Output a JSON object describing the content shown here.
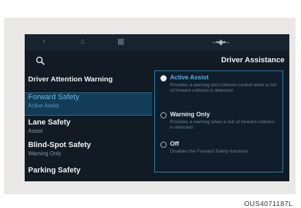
{
  "status_icons": {
    "back": "back-arrow-icon",
    "home": "home-icon",
    "menu": "grid-menu-icon",
    "connection": "connection-icon"
  },
  "left_pane": {
    "search_icon": "search-icon",
    "heading": "Driver Attention Warning",
    "items": [
      {
        "title": "Forward Safety",
        "subtitle": "Active Assist",
        "selected": true
      },
      {
        "title": "Lane Safety",
        "subtitle": "Assist"
      },
      {
        "title": "Blind-Spot Safety",
        "subtitle": "Warning Only"
      },
      {
        "title": "Parking Safety",
        "subtitle": ""
      }
    ]
  },
  "right_pane": {
    "title": "Driver Assistance",
    "options": [
      {
        "label": "Active Assist",
        "description": "Provides a warning and collision control when a risk of forward collision is detected.",
        "checked": true
      },
      {
        "label": "Warning Only",
        "description": "Provides a warning when a risk of forward collision is detected.",
        "checked": false
      },
      {
        "label": "Off",
        "description": "Disables the Forward Safety functions.",
        "checked": false
      }
    ]
  },
  "caption": "OUS4071187L",
  "colors": {
    "accent": "#2f86b9",
    "screen_bg": "#121a23",
    "selected_bg": "#123c58"
  }
}
